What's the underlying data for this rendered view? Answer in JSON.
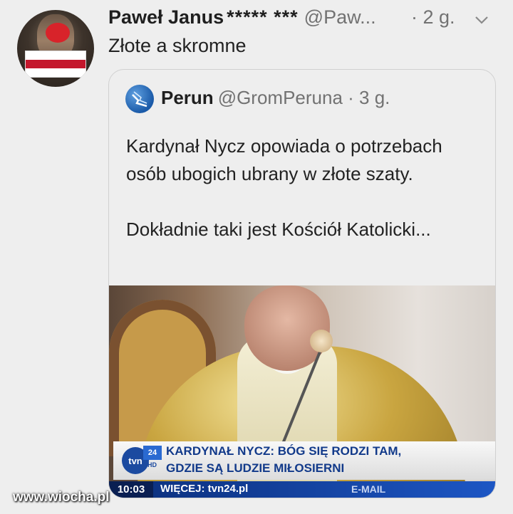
{
  "tweet": {
    "author_name": "Paweł Janus",
    "author_badge": "***** ***",
    "handle": "@Paw...",
    "time": "· 2 g.",
    "text": "Złote a skromne",
    "icons": {
      "menu": "chevron-down-icon",
      "avatar_flag_colors": [
        "#ffffff",
        "#c4172c"
      ]
    }
  },
  "quoted_tweet": {
    "author_name": "Perun",
    "handle": "@GromPeruna",
    "time": "· 3 g.",
    "paragraphs": [
      "Kardynał Nycz opowiada o potrzebach osób ubogich ubrany w złote szaty.",
      "Dokładnie taki jest Kościół Katolicki..."
    ],
    "media": {
      "channel_logo": "tvn",
      "channel_logo_number": "24",
      "channel_logo_hd": "HD",
      "headline_line1": "KARDYNAŁ NYCZ: BÓG SIĘ RODZI TAM,",
      "headline_line2": "GDZIE SĄ LUDZIE MIŁOSIERNI",
      "clock": "10:03",
      "more_text": "WIĘCEJ: tvn24.pl",
      "email_text": "E-MAIL"
    }
  },
  "watermark": "www.wiocha.pl",
  "colors": {
    "background": "#eeeeee",
    "tvn_blue": "#1b4aa0"
  }
}
